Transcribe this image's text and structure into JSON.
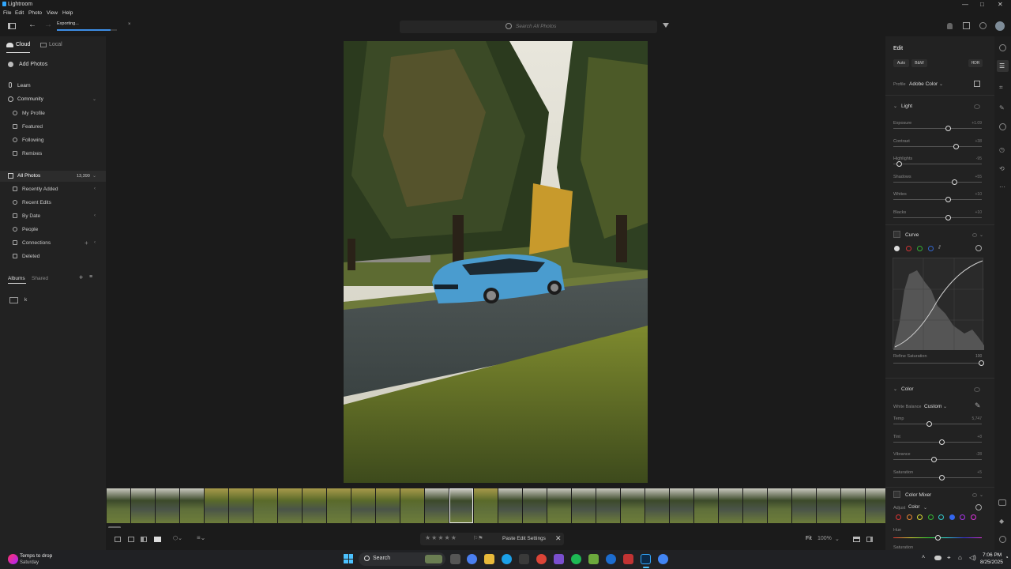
{
  "app": {
    "title": "Lightroom"
  },
  "menu": [
    "File",
    "Edit",
    "Photo",
    "View",
    "Help"
  ],
  "window_controls": {
    "minimize": "—",
    "maximize": "□",
    "close": "✕"
  },
  "toolbar": {
    "export_status": "Exporting...",
    "export_progress": 0.9,
    "search_placeholder": "Search All Photos"
  },
  "left": {
    "tabs": {
      "cloud": "Cloud",
      "local": "Local"
    },
    "add_photos": "Add Photos",
    "learn": "Learn",
    "community": "Community",
    "community_items": [
      "My Profile",
      "Featured",
      "Following",
      "Remixes"
    ],
    "all_photos": "All Photos",
    "all_photos_count": "13,390",
    "library_items": [
      "Recently Added",
      "Recent Edits",
      "By Date",
      "People",
      "Connections",
      "Deleted"
    ],
    "albums_tab": "Albums",
    "shared_tab": "Shared",
    "album_name": "k"
  },
  "bottom": {
    "paste": "Paste Edit Settings",
    "fit": "Fit",
    "zoom": "100%"
  },
  "edit": {
    "title": "Edit",
    "auto": "Auto",
    "bw": "B&W",
    "hdr": "HDR",
    "profile_label": "Profile",
    "profile_value": "Adobe Color",
    "light_title": "Light",
    "light_sliders": [
      {
        "label": "Exposure",
        "value": "+1.09",
        "pos": 0.62
      },
      {
        "label": "Contrast",
        "value": "+38",
        "pos": 0.71
      },
      {
        "label": "Highlights",
        "value": "-95",
        "pos": 0.07
      },
      {
        "label": "Shadows",
        "value": "+55",
        "pos": 0.69
      },
      {
        "label": "Whites",
        "value": "+10",
        "pos": 0.62
      },
      {
        "label": "Blacks",
        "value": "+10",
        "pos": 0.62
      }
    ],
    "curve_title": "Curve",
    "refine_label": "Refine Saturation",
    "refine_value": "100",
    "color_title": "Color",
    "wb_label": "White Balance",
    "wb_value": "Custom",
    "color_sliders": [
      {
        "label": "Temp",
        "value": "5,747",
        "pos": 0.41
      },
      {
        "label": "Tint",
        "value": "+8",
        "pos": 0.55
      },
      {
        "label": "Vibrance",
        "value": "-28",
        "pos": 0.46
      },
      {
        "label": "Saturation",
        "value": "+5",
        "pos": 0.55
      }
    ],
    "mixer_title": "Color Mixer",
    "adjust_label": "Adjust",
    "adjust_value": "Color",
    "hue_label": "Hue",
    "saturation_label": "Saturation"
  },
  "taskbar": {
    "weather_title": "Temps to drop",
    "weather_sub": "Saturday",
    "search": "Search",
    "time": "7:06 PM",
    "date": "8/25/2025"
  }
}
